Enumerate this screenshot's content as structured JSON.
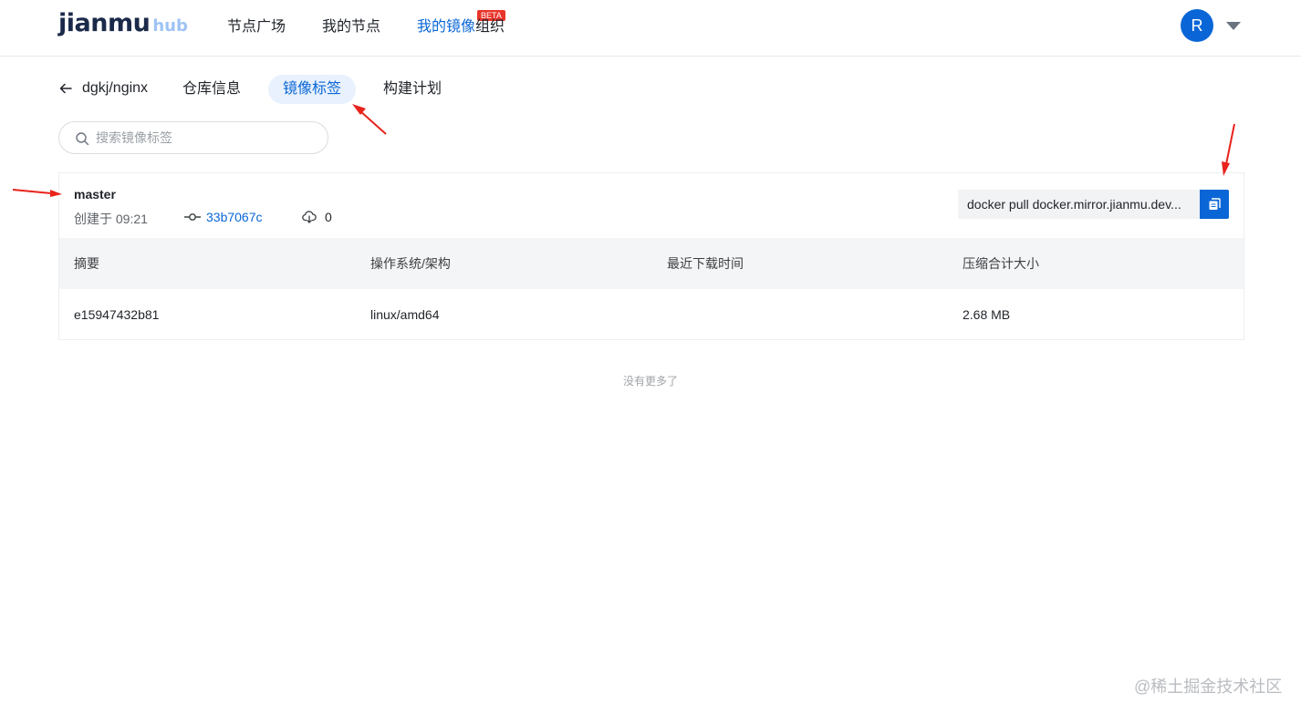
{
  "header": {
    "logo_main": "jianmu",
    "logo_hub": "hub",
    "nav": [
      {
        "label": "节点广场"
      },
      {
        "label": "我的节点"
      },
      {
        "label": "我的镜像",
        "badge": "BETA",
        "active": true
      },
      {
        "label": "组织"
      }
    ],
    "avatar_letter": "R"
  },
  "subnav": {
    "repo": "dgkj/nginx",
    "tabs": [
      {
        "label": "仓库信息"
      },
      {
        "label": "镜像标签",
        "active": true
      },
      {
        "label": "构建计划"
      }
    ]
  },
  "search": {
    "placeholder": "搜索镜像标签",
    "value": ""
  },
  "tag": {
    "name": "master",
    "created": "创建于 09:21",
    "commit": "33b7067c",
    "downloads": "0",
    "pull_command": "docker pull docker.mirror.jianmu.dev..."
  },
  "table": {
    "headers": [
      "摘要",
      "操作系统/架构",
      "最近下载时间",
      "压缩合计大小"
    ],
    "rows": [
      {
        "digest": "e15947432b81",
        "os_arch": "linux/amd64",
        "last_download": "",
        "size": "2.68 MB"
      }
    ]
  },
  "no_more": "没有更多了",
  "watermark": "@稀土掘金技术社区",
  "colors": {
    "accent": "#0a66d6",
    "annotation": "#e8231c",
    "badge": "#e8342a"
  }
}
